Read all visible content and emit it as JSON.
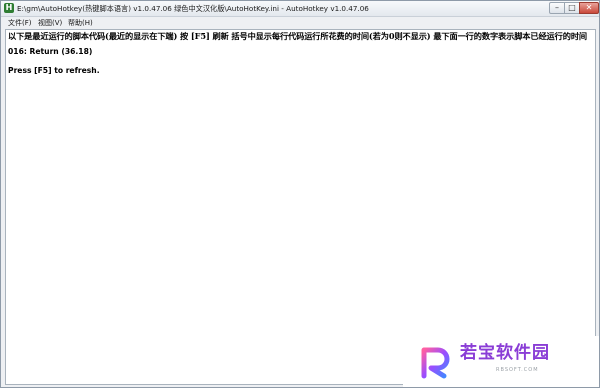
{
  "window": {
    "title": "E:\\gm\\AutoHotkey(热键脚本语言) v1.0.47.06 绿色中文汉化版\\AutoHotKey.ini - AutoHotkey v1.0.47.06",
    "minimize_label": "–",
    "maximize_label": "□",
    "close_label": "✕"
  },
  "menu": {
    "items": [
      {
        "label": "文件(F)"
      },
      {
        "label": "视图(V)"
      },
      {
        "label": "帮助(H)"
      }
    ]
  },
  "content": {
    "header": "以下是最近运行的脚本代码(最近的显示在下端) 按 [F5] 刷新  括号中显示每行代码运行所花费的时间(若为0则不显示) 最下面一行的数字表示脚本已经运行的时间",
    "lines": [
      "016: Return (36.18)",
      "Press [F5] to refresh."
    ]
  },
  "watermark": {
    "text": "若宝软件园",
    "url": "RBSOFT.COM"
  },
  "colors": {
    "close_button": "#c9483a",
    "watermark": "#8a3dd6"
  }
}
